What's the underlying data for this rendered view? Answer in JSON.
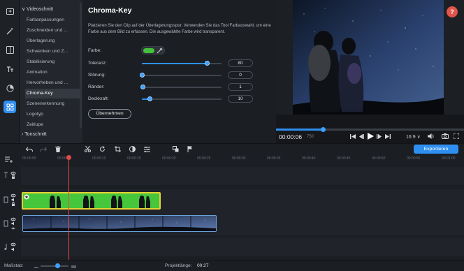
{
  "sidebar": {
    "groups": {
      "video_editing": "Videoschnitt",
      "audio_editing": "Tonschnitt"
    },
    "items": [
      "Farbanpassungen",
      "Zuschneiden und ...",
      "Überlagerung",
      "Schwenken und Z...",
      "Stabilisierung",
      "Animation",
      "Hervorheben und ...",
      "Chroma-Key",
      "Szenenerkennung",
      "Logotyp",
      "Zeitlupe"
    ],
    "selected_index": 7,
    "rail_icons": [
      "import-icon",
      "magic-wand-icon",
      "transitions-icon",
      "titles-icon",
      "filters-icon",
      "more-tools-icon"
    ]
  },
  "panel": {
    "title": "Chroma-Key",
    "description": "Platzieren Sie den Clip auf der Überlagerungsspur. Verwenden Sie das Tool Farbauswahl, um eine Farbe aus dem Bild zu erfassen. Die ausgewählte Farbe wird transparent.",
    "color_label": "Farbe:",
    "key_color": "#44c13b",
    "sliders": {
      "tolerance": {
        "label": "Toleranz:",
        "value": "80",
        "level": 0.82
      },
      "noise": {
        "label": "Störung:",
        "value": "0",
        "level": 0.0
      },
      "edges": {
        "label": "Ränder:",
        "value": "1",
        "level": 0.01
      },
      "opacity": {
        "label": "Deckkraft:",
        "value": "10",
        "level": 0.1
      }
    },
    "apply_button": "Übernehmen"
  },
  "player": {
    "current_time": "00:00:06",
    "frame": "750",
    "progress": 0.25,
    "aspect": "16:9",
    "help": "?"
  },
  "toolbar": {
    "export_button": "Exportieren"
  },
  "timeline": {
    "ticks": [
      "00:00:00",
      "00:00:05",
      "00:00:10",
      "00:00:15",
      "00:00:20",
      "00:00:25",
      "00:00:30",
      "00:00:35",
      "00:00:40",
      "00:00:45",
      "00:00:50",
      "00:00:55",
      "00:01:00",
      "00:01:05"
    ]
  },
  "footer": {
    "scale_label": "Maßstab:",
    "length_label": "Projektlänge:",
    "length_value": "00:27"
  },
  "colors": {
    "accent": "#2f8ff0",
    "playhead": "#e04a48",
    "chroma_clip": "#46c63b",
    "clip_selected_border": "#e7d235",
    "help_button": "#e0544a"
  }
}
